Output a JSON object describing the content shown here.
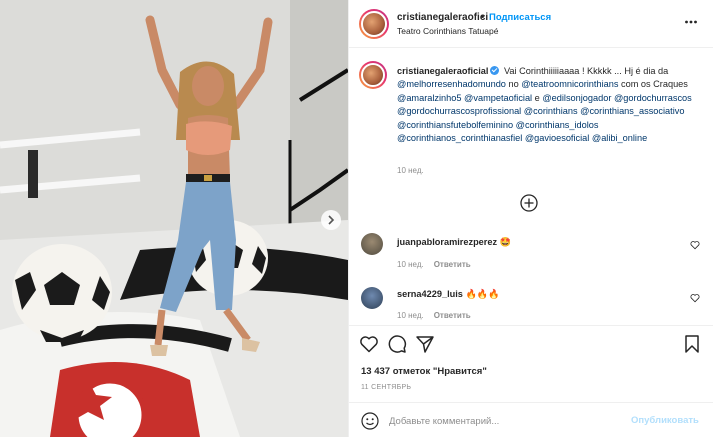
{
  "header": {
    "username": "cristianegaleraofici",
    "follow_label": "Подписаться",
    "separator": "•",
    "location": "Teatro Corinthians Tatuapé",
    "more_icon": "more-dots-icon"
  },
  "caption": {
    "username": "cristianegaleraoficial",
    "text_start": "Vai Corinthiiiiiaaaa ! Kkkkk ... Hj é dia da",
    "mention_1": "@melhorresenhadomundo",
    "text_mid_1": " no ",
    "mention_2": "@teatroomnicorinthians",
    "text_mid_2": " com os Craques ",
    "mention_3": "@amaralzinho5",
    "mention_4": "@vampetaoficial",
    "text_mid_3": " e ",
    "mention_5": "@edilsonjogador",
    "mention_6": "@gordochurrascos",
    "mention_7": "@gordochurrascosprofissional",
    "mention_8": "@corinthians",
    "mention_9": "@corinthians_associativo",
    "mention_10": "@corinthiansfutebolfeminino",
    "mention_11": "@corinthians_idolos",
    "mention_12": "@corinthianos_corinthianasfiel",
    "mention_13": "@gavioesoficial",
    "mention_14": "@alibi_online",
    "time": "10 нед."
  },
  "comments": [
    {
      "username": "juanpabloramirezperez",
      "text": "🤩",
      "time": "10 нед.",
      "reply": "Ответить"
    },
    {
      "username": "serna4229_luis",
      "text": "🔥🔥🔥",
      "time": "10 нед.",
      "reply": "Ответить"
    }
  ],
  "actions": {
    "likes_count": "13 437",
    "likes_label": "отметок \"Нравится\"",
    "date": "11 СЕНТЯБРЬ"
  },
  "add_comment": {
    "placeholder": "Добавьте комментарий...",
    "publish_label": "Опубликовать"
  },
  "colors": {
    "link_blue": "#0095f6",
    "mention": "#00376b",
    "muted": "#8e8e8e",
    "publish_disabled": "#b2dffc"
  }
}
